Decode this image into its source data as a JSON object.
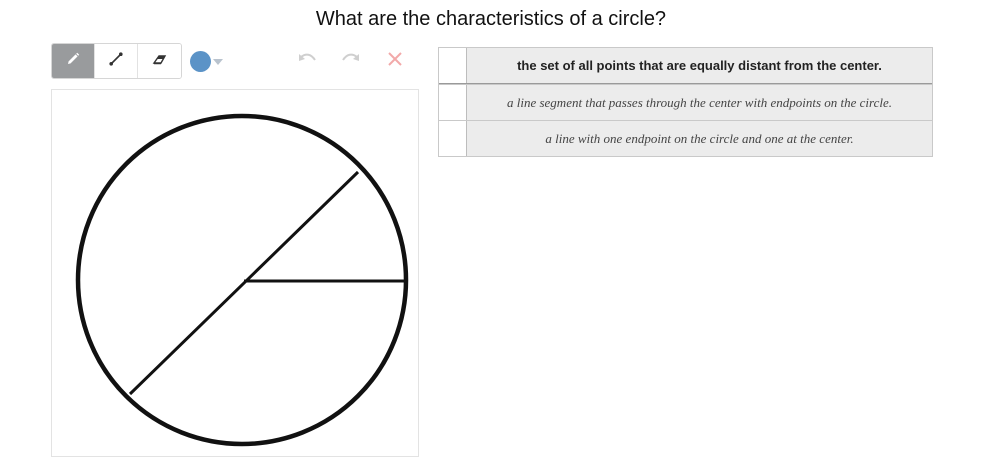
{
  "question": "What are the characteristics of a circle?",
  "toolbar": {
    "tools": [
      {
        "name": "pencil-icon",
        "active": true
      },
      {
        "name": "line-icon",
        "active": false
      },
      {
        "name": "eraser-icon",
        "active": false
      }
    ],
    "color": "#5b93c7"
  },
  "history": {
    "undo_icon": "undo-icon",
    "redo_icon": "redo-icon",
    "clear_icon": "close-icon"
  },
  "options": [
    {
      "text": "the set of all points that are equally distant from the center.",
      "selected": true
    },
    {
      "text": "a line segment that passes through the center with endpoints on the circle.",
      "selected": false
    },
    {
      "text": "a line with one endpoint on the circle and one at the center.",
      "selected": false
    }
  ]
}
